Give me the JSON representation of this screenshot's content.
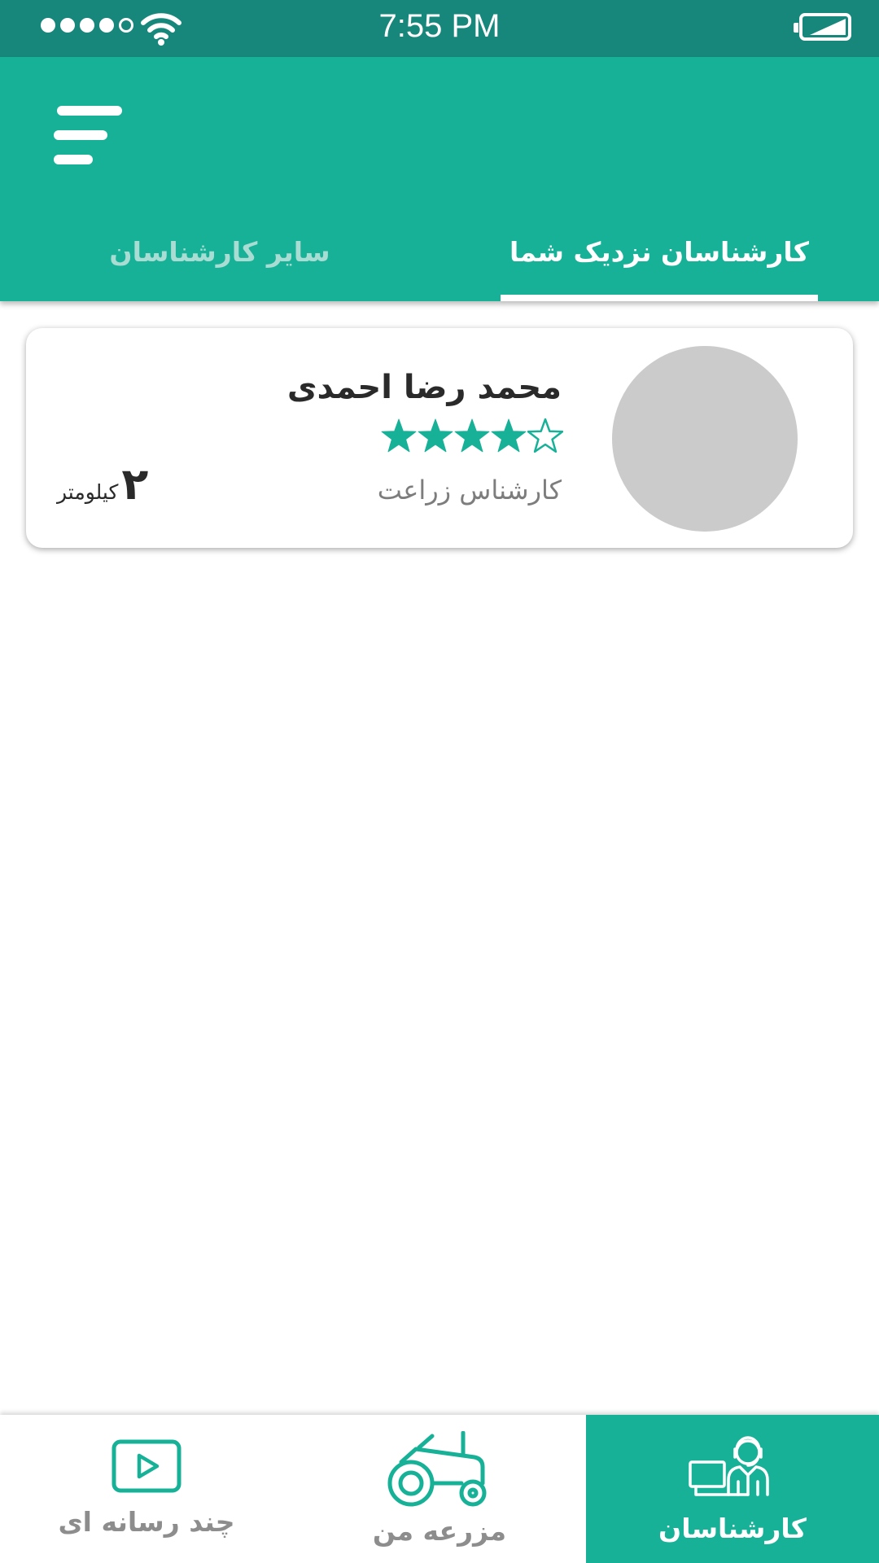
{
  "status_bar": {
    "time": "7:55 PM",
    "signal_bars_filled": 4,
    "signal_bars_total": 5
  },
  "colors": {
    "status_bar": "#17877c",
    "primary": "#17b198",
    "avatar_placeholder": "#cbcbcb",
    "tab_inactive": "#a9ddd4"
  },
  "header": {
    "menu_icon": "hamburger-menu-icon",
    "tabs": [
      {
        "label": "کارشناسان نزدیک شما",
        "active": true
      },
      {
        "label": "سایر کارشناسان",
        "active": false
      }
    ]
  },
  "experts": [
    {
      "name": "محمد رضا احمدی",
      "role": "کارشناس زراعت",
      "rating": 4,
      "rating_max": 5,
      "distance_value": "۲",
      "distance_unit": "کیلومتر"
    }
  ],
  "bottom_nav": {
    "items": [
      {
        "label": "کارشناسان",
        "icon": "expert-agent-icon",
        "active": true
      },
      {
        "label": "مزرعه من",
        "icon": "tractor-icon",
        "active": false
      },
      {
        "label": "چند رسانه ای",
        "icon": "video-play-icon",
        "active": false
      }
    ]
  }
}
